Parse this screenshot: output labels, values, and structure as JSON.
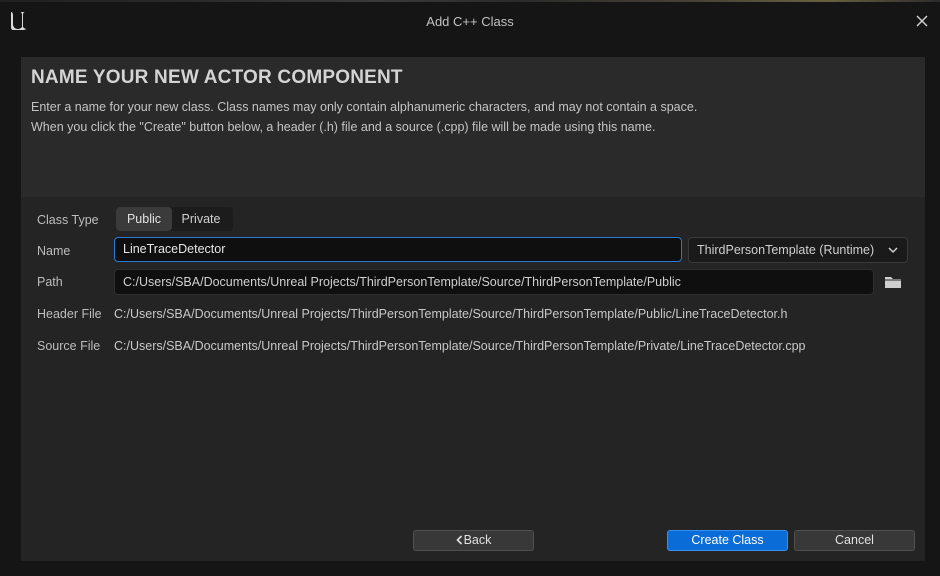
{
  "window": {
    "title": "Add C++ Class"
  },
  "header": {
    "heading": "NAME YOUR NEW ACTOR COMPONENT",
    "description_line1": "Enter a name for your new class. Class names may only contain alphanumeric characters, and may not contain a space.",
    "description_line2": "When you click the \"Create\" button below, a header (.h) file and a source (.cpp) file will be made using this name."
  },
  "form": {
    "class_type": {
      "label": "Class Type",
      "options": [
        "Public",
        "Private"
      ],
      "selected": "Public"
    },
    "name": {
      "label": "Name",
      "value": "LineTraceDetector"
    },
    "module": {
      "selected": "ThirdPersonTemplate (Runtime)"
    },
    "path": {
      "label": "Path",
      "value": "C:/Users/SBA/Documents/Unreal Projects/ThirdPersonTemplate/Source/ThirdPersonTemplate/Public"
    },
    "header_file": {
      "label": "Header File",
      "value": "C:/Users/SBA/Documents/Unreal Projects/ThirdPersonTemplate/Source/ThirdPersonTemplate/Public/LineTraceDetector.h"
    },
    "source_file": {
      "label": "Source File",
      "value": "C:/Users/SBA/Documents/Unreal Projects/ThirdPersonTemplate/Source/ThirdPersonTemplate/Private/LineTraceDetector.cpp"
    }
  },
  "buttons": {
    "back": "Back",
    "create": "Create Class",
    "cancel": "Cancel"
  },
  "icons": {
    "logo": "unreal-engine-logo",
    "close": "close-icon",
    "dropdown": "chevron-down-icon",
    "browse": "folder-icon",
    "back": "chevron-left-icon"
  },
  "colors": {
    "accent": "#0a6cd6",
    "focus_border": "#2a7ad5",
    "panel": "#242424",
    "window_bg": "#151515"
  }
}
